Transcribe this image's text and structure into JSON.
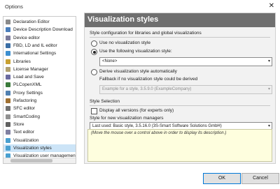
{
  "window": {
    "title": "Options"
  },
  "sidebar": {
    "items": [
      {
        "label": "Declaration Editor",
        "icon": "declaration-editor-icon",
        "color": "#8a8a8a"
      },
      {
        "label": "Device Description Download",
        "icon": "download-icon",
        "color": "#4a7ebb"
      },
      {
        "label": "Device editor",
        "icon": "device-icon",
        "color": "#7a7a9a"
      },
      {
        "label": "FBD, LD and IL editor",
        "icon": "fbd-icon",
        "color": "#3a6ea5"
      },
      {
        "label": "International Settings",
        "icon": "globe-icon",
        "color": "#3d8fd0"
      },
      {
        "label": "Libraries",
        "icon": "library-icon",
        "color": "#c8a030"
      },
      {
        "label": "License Manager",
        "icon": "license-icon",
        "color": "#b0a070"
      },
      {
        "label": "Load and Save",
        "icon": "save-icon",
        "color": "#6a6aa0"
      },
      {
        "label": "PLCopenXML",
        "icon": "xml-icon",
        "color": "#3a7a3a"
      },
      {
        "label": "Proxy Settings",
        "icon": "proxy-icon",
        "color": "#5080b0"
      },
      {
        "label": "Refactoring",
        "icon": "refactoring-icon",
        "color": "#a07030"
      },
      {
        "label": "SFC editor",
        "icon": "sfc-icon",
        "color": "#707070"
      },
      {
        "label": "SmartCoding",
        "icon": "smartcoding-icon",
        "color": "#909090"
      },
      {
        "label": "Store",
        "icon": "store-icon",
        "color": "#606060"
      },
      {
        "label": "Text editor",
        "icon": "text-editor-icon",
        "color": "#8080a0"
      },
      {
        "label": "Visualization",
        "icon": "visualization-icon",
        "color": "#4aa0d0"
      },
      {
        "label": "Visualization styles",
        "icon": "visualization-styles-icon",
        "color": "#4aa0d0"
      },
      {
        "label": "Visualization user management",
        "icon": "user-management-icon",
        "color": "#4aa0d0"
      }
    ],
    "selected_index": 16
  },
  "panel": {
    "title": "Visualization styles",
    "style_config_title": "Style configuration for libraries and global visualizations",
    "options": {
      "no_style": "Use no visualization style",
      "following_style": "Use the following visualization style:",
      "following_style_value": "<None>",
      "derive_style": "Derive visualization style automatically",
      "fallback_label": "Fallback if no visualization style could be derived",
      "fallback_value": "Example for a style, 3.5.9.0 (ExampleCompany)"
    },
    "selected_option": "following_style",
    "style_selection_title": "Style Selection",
    "display_all_versions": "Display all versions (for experts only)",
    "display_all_checked": false,
    "managers_title": "Style for new visualization managers",
    "managers_value": "Last used: Basic style, 3.5.16.0 (3S-Smart Software Solutions GmbH)",
    "description_hint": "(Move the mouse over a control above in order to display its description.)"
  },
  "buttons": {
    "ok": "OK",
    "cancel": "Cancel"
  },
  "colors": {
    "header_bg": "#6f6f6f",
    "selected_bg": "#cce4f7",
    "description_bg": "#fefede",
    "ok_border": "#0078d7"
  }
}
